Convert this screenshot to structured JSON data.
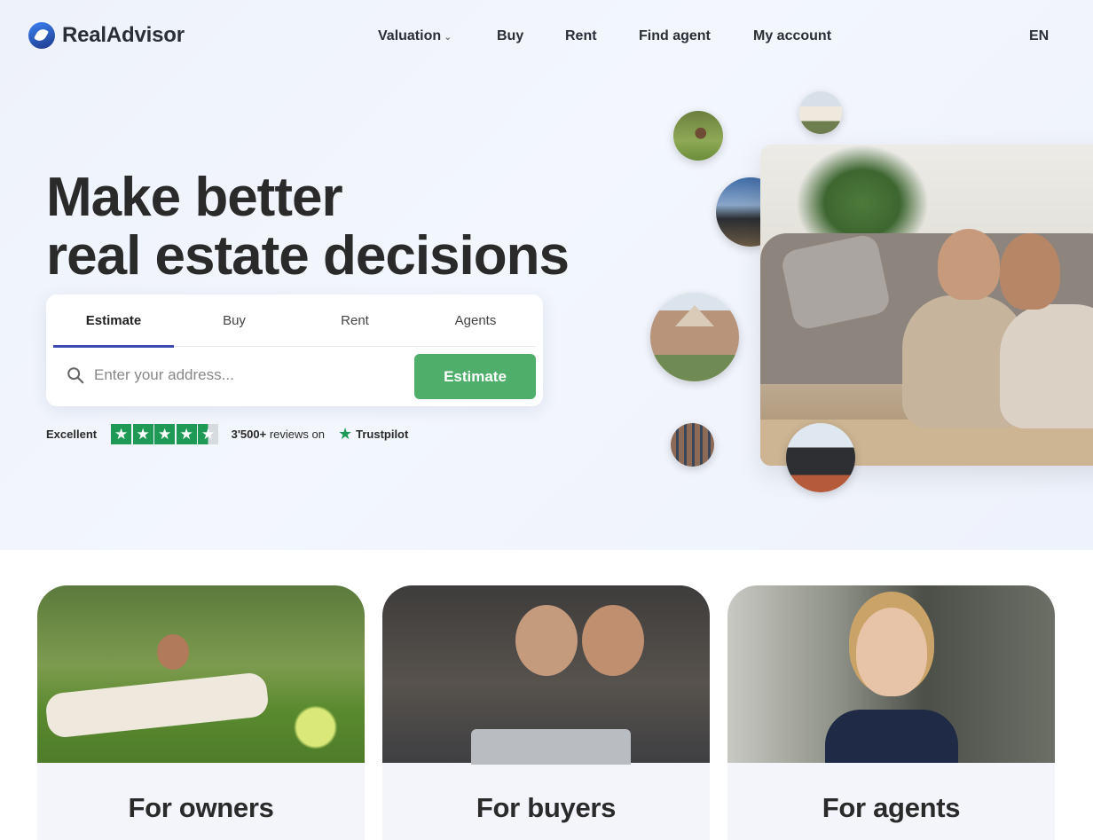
{
  "header": {
    "logo_text": "RealAdvisor",
    "nav": [
      {
        "label": "Valuation",
        "has_dropdown": true
      },
      {
        "label": "Buy"
      },
      {
        "label": "Rent"
      },
      {
        "label": "Find agent"
      },
      {
        "label": "My account"
      }
    ],
    "language": "EN"
  },
  "hero": {
    "headline_line1": "Make better",
    "headline_line2": "real estate decisions",
    "search": {
      "tabs": [
        "Estimate",
        "Buy",
        "Rent",
        "Agents"
      ],
      "active_tab": "Estimate",
      "placeholder": "Enter your address...",
      "button_label": "Estimate"
    },
    "trustpilot": {
      "rating_label": "Excellent",
      "stars": 4.5,
      "count": "3'500+",
      "reviews_text": "reviews on",
      "brand": "Trustpilot"
    }
  },
  "cards": [
    {
      "title": "For owners"
    },
    {
      "title": "For buyers"
    },
    {
      "title": "For agents"
    }
  ],
  "colors": {
    "accent_green": "#4fae6a",
    "trustpilot_green": "#1f9a56",
    "tab_underline": "#3c4bb0",
    "hero_bg": "#eef2fb"
  }
}
